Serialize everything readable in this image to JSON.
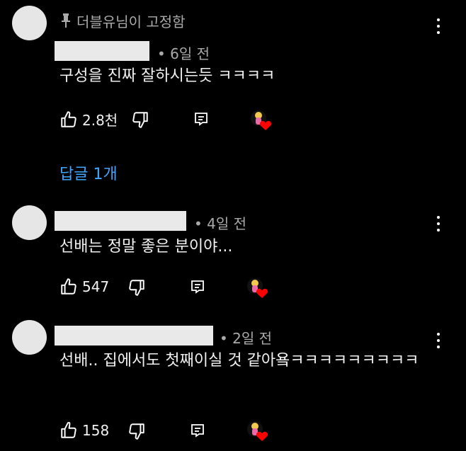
{
  "comments": [
    {
      "pinned_label": "더블유님이 고정함",
      "time": "6일 전",
      "text": "구성을 진짜 잘하시는듯 ㅋㅋㅋㅋ",
      "likes": "2.8천",
      "reply_link": "답글 1개"
    },
    {
      "time": "4일 전",
      "text": "선배는 정말 좋은 분이야...",
      "likes": "547"
    },
    {
      "time": "2일 전",
      "text": "선배.. 집에서도 첫째이실 것 같아욬ㅋㅋㅋㅋㅋㅋㅋㅋㅋ",
      "likes": "158"
    }
  ],
  "icons": {
    "like": "thumbs-up-icon",
    "dislike": "thumbs-down-icon",
    "reply": "reply-comment-icon",
    "more": "more-vert-icon",
    "pin": "pin-icon",
    "creator_heart": "creator-heart-badge"
  },
  "colors": {
    "background": "#000000",
    "link": "#3ea6ff",
    "secondary_text": "#aaaaaa",
    "heart": "#ff0000"
  }
}
